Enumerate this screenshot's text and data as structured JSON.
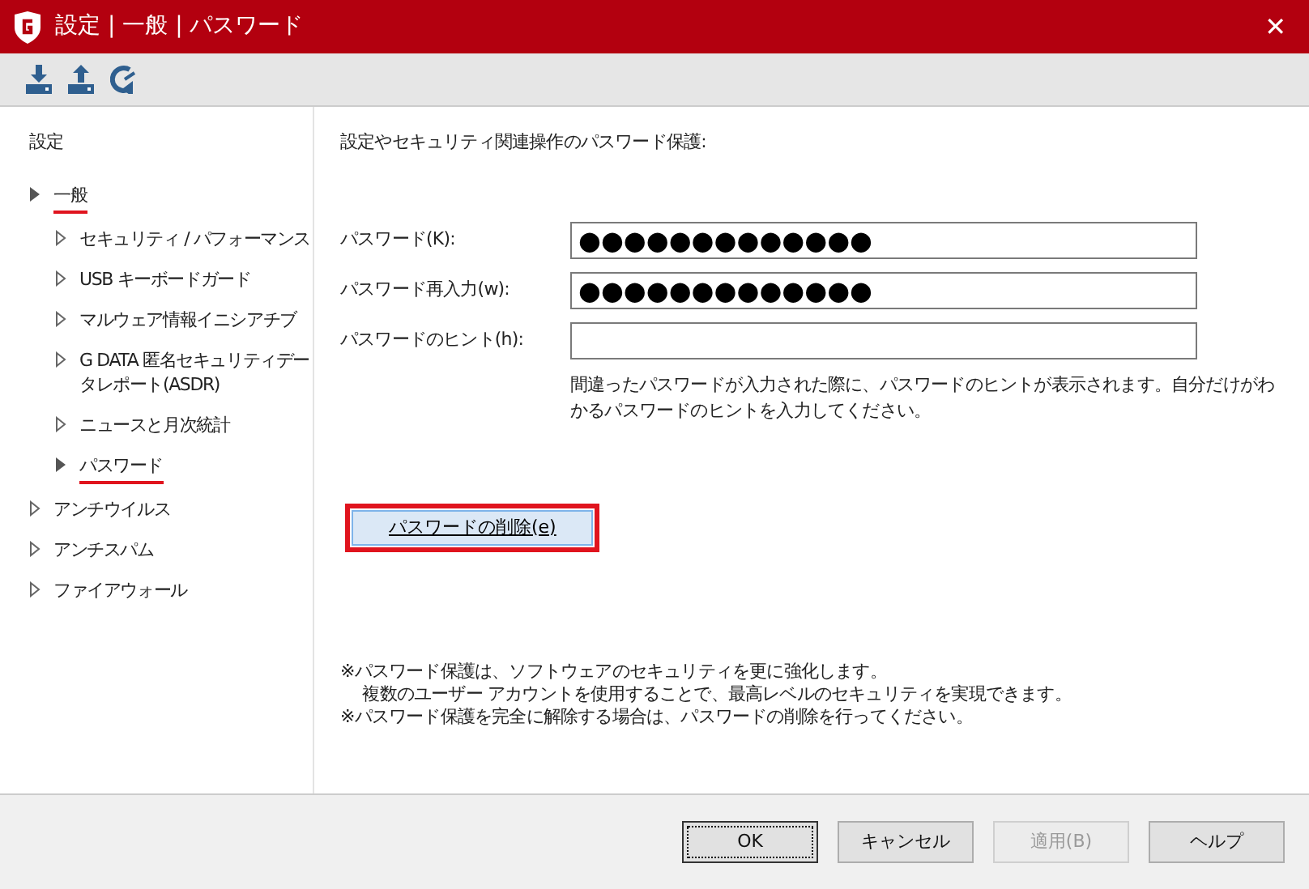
{
  "window": {
    "title": "設定 | 一般 | パスワード",
    "close": "✕"
  },
  "toolbar": [
    {
      "kind": "import"
    },
    {
      "kind": "export"
    },
    {
      "kind": "reset"
    }
  ],
  "sidebar": {
    "heading": "設定",
    "items": [
      {
        "label": "一般",
        "selected": true,
        "highlighted": true,
        "children": [
          {
            "label": "セキュリティ / パフォーマンス",
            "selected": false,
            "highlighted": false
          },
          {
            "label": "USB キーボードガード",
            "selected": false,
            "highlighted": false
          },
          {
            "label": "マルウェア情報イニシアチブ",
            "selected": false,
            "highlighted": false
          },
          {
            "label": "G DATA 匿名セキュリティデータレポート(ASDR)",
            "selected": false,
            "highlighted": false
          },
          {
            "label": "ニュースと月次統計",
            "selected": false,
            "highlighted": false
          },
          {
            "label": "パスワード",
            "selected": true,
            "highlighted": true
          }
        ]
      },
      {
        "label": "アンチウイルス",
        "selected": false,
        "highlighted": false
      },
      {
        "label": "アンチスパム",
        "selected": false,
        "highlighted": false
      },
      {
        "label": "ファイアウォール",
        "selected": false,
        "highlighted": false
      }
    ]
  },
  "content": {
    "intro": "設定やセキュリティ関連操作のパスワード保護:",
    "fields": [
      {
        "label": "パスワード(K):",
        "value": "●●●●●●●●●●●●●"
      },
      {
        "label": "パスワード再入力(w):",
        "value": "●●●●●●●●●●●●●"
      },
      {
        "label": "パスワードのヒント(h):"
      }
    ],
    "hint": "間違ったパスワードが入力された際に、パスワードのヒントが表示されます。自分だけがわかるパスワードのヒントを入力してください。",
    "delete_button": {
      "label": "パスワードの削除(e)",
      "highlighted": true
    },
    "notes": [
      "※パスワード保護は、ソフトウェアのセキュリティを更に強化します。",
      "　 複数のユーザー アカウントを使用することで、最高レベルのセキュリティを実現できます。",
      "※パスワード保護を完全に解除する場合は、パスワードの削除を行ってください。"
    ]
  },
  "buttons": [
    {
      "label": "OK",
      "disabled": false,
      "focused": true
    },
    {
      "label": "キャンセル",
      "disabled": false,
      "focused": false
    },
    {
      "label": "適用(B)",
      "disabled": true,
      "focused": false
    },
    {
      "label": "ヘルプ",
      "disabled": false,
      "focused": false
    }
  ]
}
